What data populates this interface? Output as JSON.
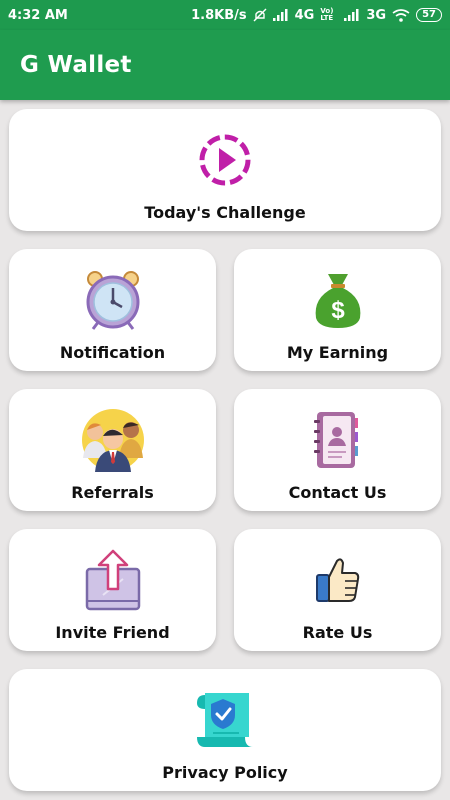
{
  "status_bar": {
    "time": "4:32 AM",
    "speed": "1.8KB/s",
    "net1": "4G",
    "net1_sub": "Vo) LTE",
    "net2": "3G",
    "battery": "57"
  },
  "app": {
    "title": "G Wallet"
  },
  "menu": {
    "challenge": {
      "label": "Today's Challenge",
      "icon": "play-circle-icon"
    },
    "notification": {
      "label": "Notification",
      "icon": "alarm-clock-icon"
    },
    "earning": {
      "label": "My Earning",
      "icon": "money-bag-icon"
    },
    "referrals": {
      "label": "Referrals",
      "icon": "people-group-icon"
    },
    "contact": {
      "label": "Contact Us",
      "icon": "address-book-icon"
    },
    "invite": {
      "label": "Invite Friend",
      "icon": "share-upload-icon"
    },
    "rate": {
      "label": "Rate Us",
      "icon": "thumbs-up-icon"
    },
    "privacy": {
      "label": "Privacy Policy",
      "icon": "shield-document-icon"
    }
  },
  "colors": {
    "primary": "#1f9c4f",
    "challenge_accent": "#c01fa8",
    "background": "#e9e7e7"
  }
}
